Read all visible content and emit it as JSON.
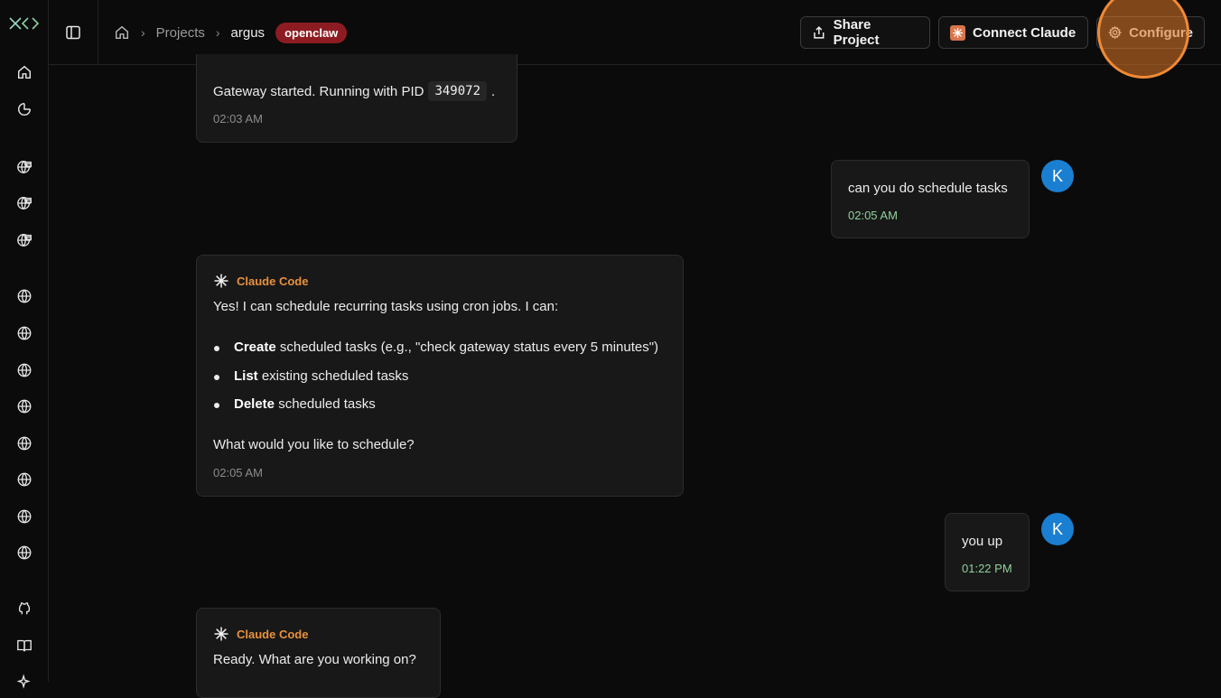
{
  "breadcrumb": {
    "projects": "Projects",
    "project": "argus",
    "tag": "openclaw"
  },
  "header": {
    "share_label": "Share Project",
    "connect_label": "Connect Claude",
    "configure_label": "Configure"
  },
  "rail": {
    "icons": [
      "home-icon",
      "analytics-icon",
      "globe-lock-icon",
      "globe-lock-icon",
      "globe-lock-icon",
      "globe-icon",
      "globe-icon",
      "globe-icon",
      "globe-icon",
      "globe-icon",
      "globe-icon",
      "globe-icon",
      "globe-icon",
      "github-icon",
      "book-icon",
      "sparkle-icon"
    ]
  },
  "messages": {
    "m1": {
      "text_before": "Gateway started. Running with PID",
      "code": "349072",
      "text_after": ".",
      "time": "02:03 AM"
    },
    "m2": {
      "avatar": "K",
      "text": "can you do schedule tasks",
      "time": "02:05 AM"
    },
    "m3": {
      "author": "Claude Code",
      "intro": "Yes! I can schedule recurring tasks using cron jobs. I can:",
      "items": [
        {
          "bold": "Create",
          "rest": "scheduled tasks (e.g., \"check gateway status every 5 minutes\")"
        },
        {
          "bold": "List",
          "rest": "existing scheduled tasks"
        },
        {
          "bold": "Delete",
          "rest": "scheduled tasks"
        }
      ],
      "outro": "What would you like to schedule?",
      "time": "02:05 AM"
    },
    "m4": {
      "avatar": "K",
      "text": "you up",
      "time": "01:22 PM"
    },
    "m5": {
      "author": "Claude Code",
      "text": "Ready. What are you working on?"
    }
  },
  "colors": {
    "accent_orange": "#e8913c",
    "tag_red": "#8d1c22",
    "avatar_blue": "#1b7fd1",
    "user_time_green": "#8fd19e"
  }
}
